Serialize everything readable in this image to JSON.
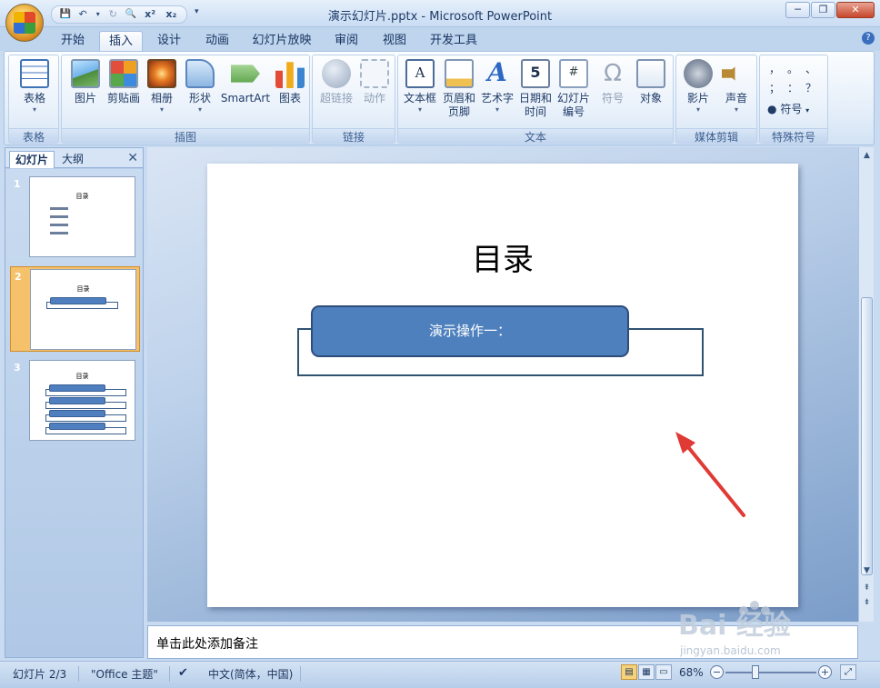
{
  "window": {
    "title": "演示幻灯片.pptx - Microsoft PowerPoint",
    "min": "─",
    "max": "❐",
    "close": "✕"
  },
  "qat": {
    "save": "💾",
    "undo": "↶",
    "undo_arrow": "▾",
    "redo": "↻",
    "preview": "🔍",
    "superscript": "x²",
    "subscript": "x₂",
    "customize": "▾"
  },
  "tabs": [
    "开始",
    "插入",
    "设计",
    "动画",
    "幻灯片放映",
    "审阅",
    "视图",
    "开发工具"
  ],
  "help_icon": "?",
  "ribbon": {
    "groups": {
      "table": "表格",
      "illustrations": "插图",
      "links": "链接",
      "text": "文本",
      "media": "媒体剪辑",
      "symbols": "特殊符号"
    },
    "buttons": {
      "table": "表格",
      "picture": "图片",
      "clipart": "剪贴画",
      "album": "相册",
      "shapes": "形状",
      "smartart": "SmartArt",
      "chart": "图表",
      "hyperlink": "超链接",
      "action": "动作",
      "textbox": "文本框",
      "header_footer_1": "页眉和",
      "header_footer_2": "页脚",
      "wordart": "艺术字",
      "datetime_1": "日期和",
      "datetime_2": "时间",
      "slidenum_1": "幻灯片",
      "slidenum_2": "编号",
      "symbol": "符号",
      "object": "对象",
      "movie": "影片",
      "sound": "声音",
      "special_symbol": "符号"
    },
    "icon_glyphs": {
      "textbox": "A",
      "wordart": "A",
      "date": "5",
      "slidenum": "#",
      "omega": "Ω"
    },
    "special_chars": [
      "，",
      "。",
      "、",
      "；",
      "：",
      "？"
    ],
    "dropdown": "▾"
  },
  "left_pane": {
    "tab_slides": "幻灯片",
    "tab_outline": "大纲",
    "close": "✕"
  },
  "thumbnails": [
    {
      "num": "1",
      "title": "目录"
    },
    {
      "num": "2",
      "title": "目录"
    },
    {
      "num": "3",
      "title": "目录"
    }
  ],
  "slide": {
    "title": "目录",
    "box_text": "演示操作一："
  },
  "notes_placeholder": "单击此处添加备注",
  "status": {
    "slide": "幻灯片 2/3",
    "theme": "\"Office 主题\"",
    "language": "中文(简体，中国)",
    "zoom": "68%",
    "zoom_minus": "−",
    "zoom_plus": "+"
  },
  "scroll": {
    "up": "▲",
    "down": "▼",
    "prev": "⇞",
    "next": "⇟"
  },
  "watermark": {
    "brand": "Bai 经验",
    "url": "jingyan.baidu.com"
  },
  "colors": {
    "accent_box": "#4e80bd",
    "arrow": "#e03a35",
    "selected_thumb": "#f5c16a"
  }
}
